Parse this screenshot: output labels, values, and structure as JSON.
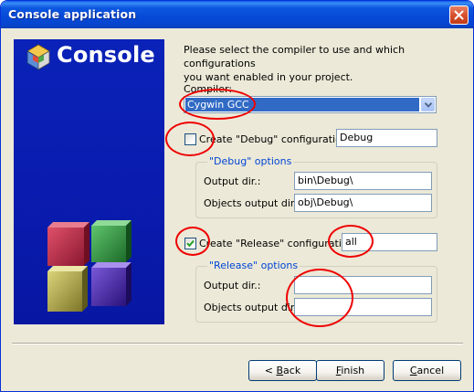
{
  "window": {
    "title": "Console application"
  },
  "side_panel": {
    "brand": "Console",
    "colors": {
      "background": "#0a22b8",
      "cube_red": "#b0263a",
      "cube_green": "#2f8f3c",
      "cube_yellow": "#b7b04a",
      "cube_purple": "#4a2a9a"
    }
  },
  "intro": {
    "line1": "Please select the compiler to use and which configurations",
    "line2": "you want enabled in your project."
  },
  "compiler": {
    "label": "Compiler:",
    "selected": "Cygwin GCC"
  },
  "debug": {
    "checkbox_label": "Create \"Debug\" configuration:",
    "checked": false,
    "name_value": "Debug",
    "group_title": "\"Debug\" options",
    "output_dir_label": "Output dir.:",
    "output_dir_value": "bin\\Debug\\",
    "objects_dir_label": "Objects output dir.:",
    "objects_dir_value": "obj\\Debug\\"
  },
  "release": {
    "checkbox_label": "Create \"Release\" configuration:",
    "checked": true,
    "name_value": "all",
    "group_title": "\"Release\" options",
    "output_dir_label": "Output dir.:",
    "output_dir_value": "",
    "objects_dir_label": "Objects output dir.:",
    "objects_dir_value": ""
  },
  "buttons": {
    "back_prefix": "< ",
    "back_mnemonic": "B",
    "back_rest": "ack",
    "finish_mnemonic": "F",
    "finish_rest": "inish",
    "cancel_mnemonic": "C",
    "cancel_rest": "ancel"
  },
  "annotation_color": "#ee0000"
}
